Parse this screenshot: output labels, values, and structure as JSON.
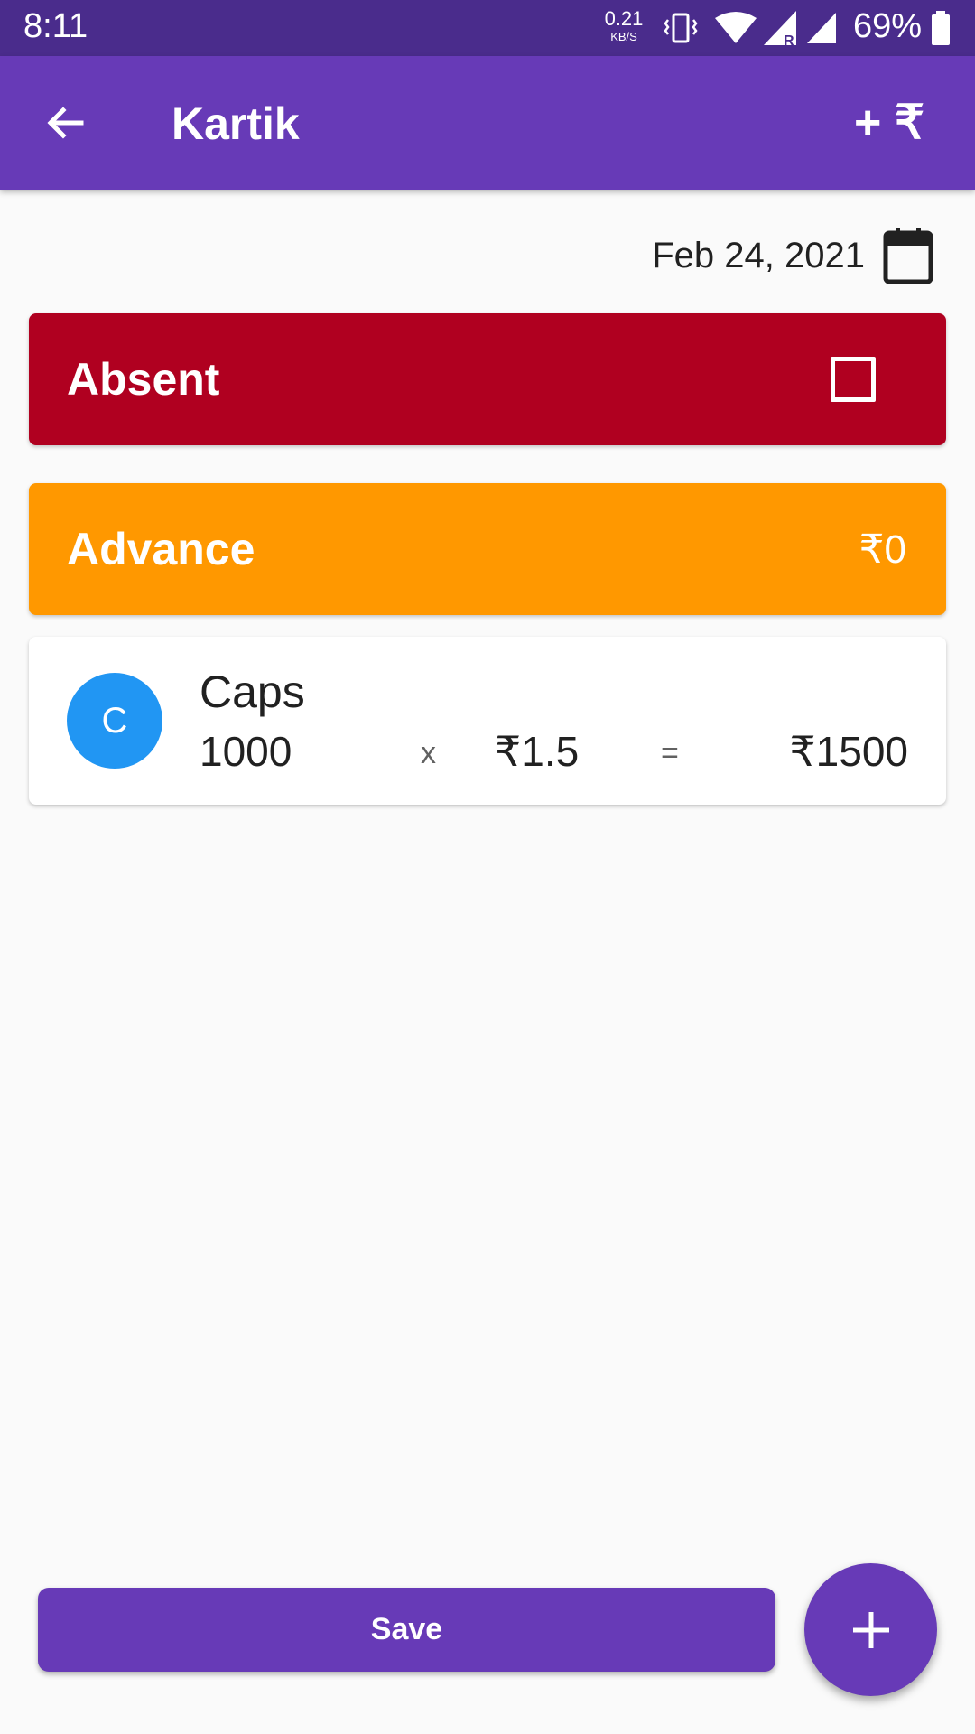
{
  "status_bar": {
    "time": "8:11",
    "net_speed_value": "0.21",
    "net_speed_unit": "KB/S",
    "battery": "69%",
    "icons": [
      "vibrate-icon",
      "wifi-icon",
      "signal-roaming-icon",
      "signal-icon",
      "battery-icon"
    ]
  },
  "app_bar": {
    "title": "Kartik",
    "back_icon": "arrow-back-icon",
    "action_label": "+ ₹"
  },
  "date": {
    "text": "Feb 24, 2021",
    "icon": "calendar-icon"
  },
  "absent": {
    "label": "Absent",
    "checked": false,
    "color": "#b00020"
  },
  "advance": {
    "label": "Advance",
    "amount": "₹0",
    "color": "#ff9800"
  },
  "items": [
    {
      "avatar_letter": "C",
      "name": "Caps",
      "quantity": "1000",
      "times": "x",
      "rate": "₹1.5",
      "equals": "=",
      "total": "₹1500"
    }
  ],
  "footer": {
    "save_label": "Save",
    "fab_icon": "plus-icon"
  },
  "colors": {
    "primary": "#673ab7",
    "primary_dark": "#4a2c8c",
    "avatar": "#2196f3"
  }
}
